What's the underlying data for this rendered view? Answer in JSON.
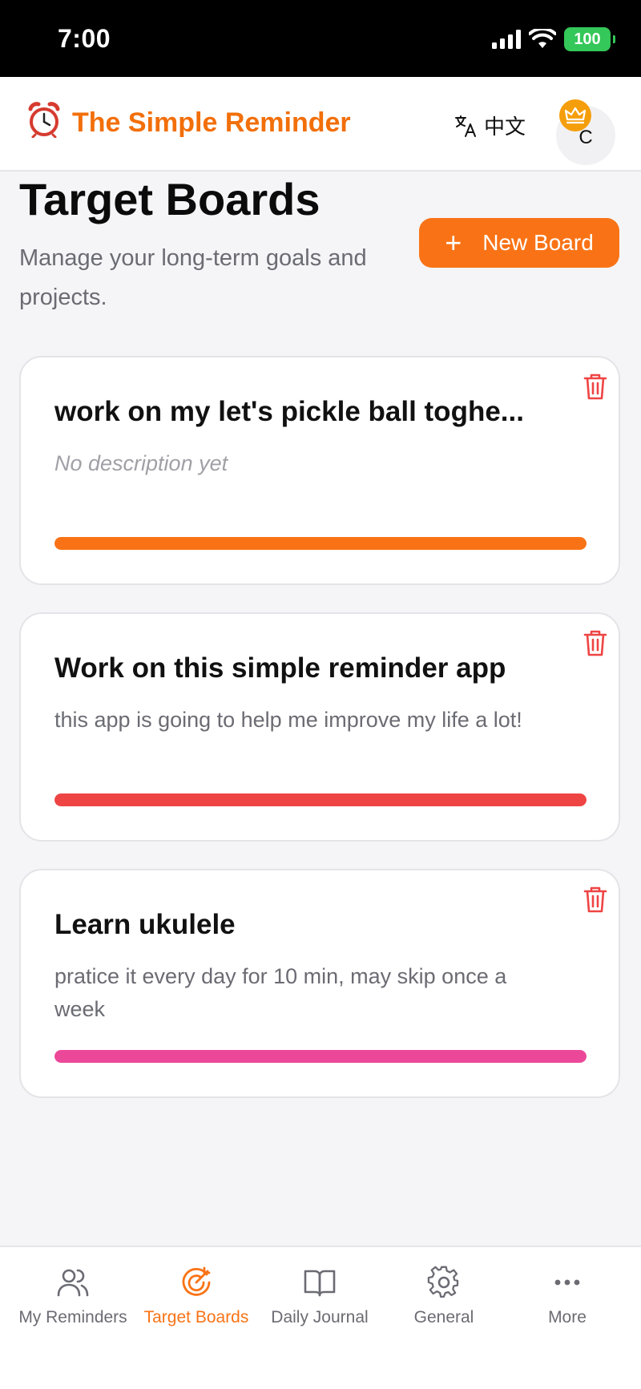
{
  "status_bar": {
    "time": "7:00",
    "battery": "100"
  },
  "header": {
    "app_title": "The Simple Reminder",
    "language_label": "中文",
    "avatar_initial": "C"
  },
  "page": {
    "title": "Target Boards",
    "subtitle": "Manage your long-term goals and projects.",
    "new_board_label": "New Board"
  },
  "boards": [
    {
      "title": "work on my let's pickle ball toghe...",
      "description": "No description yet",
      "color": "#f97316"
    },
    {
      "title": "Work on this simple reminder app",
      "description": "this app is going to help me improve my life a lot!",
      "color": "#ef4444"
    },
    {
      "title": "Learn ukulele",
      "description": "pratice it every day for 10 min, may skip once a week",
      "color": "#ec4899"
    }
  ],
  "nav": {
    "items": [
      {
        "label": "My Reminders",
        "icon": "users-icon"
      },
      {
        "label": "Target Boards",
        "icon": "target-icon"
      },
      {
        "label": "Daily Journal",
        "icon": "book-icon"
      },
      {
        "label": "General",
        "icon": "gear-icon"
      },
      {
        "label": "More",
        "icon": "more-icon"
      }
    ],
    "active_index": 1
  },
  "colors": {
    "accent": "#f97316",
    "danger": "#ef4444"
  }
}
